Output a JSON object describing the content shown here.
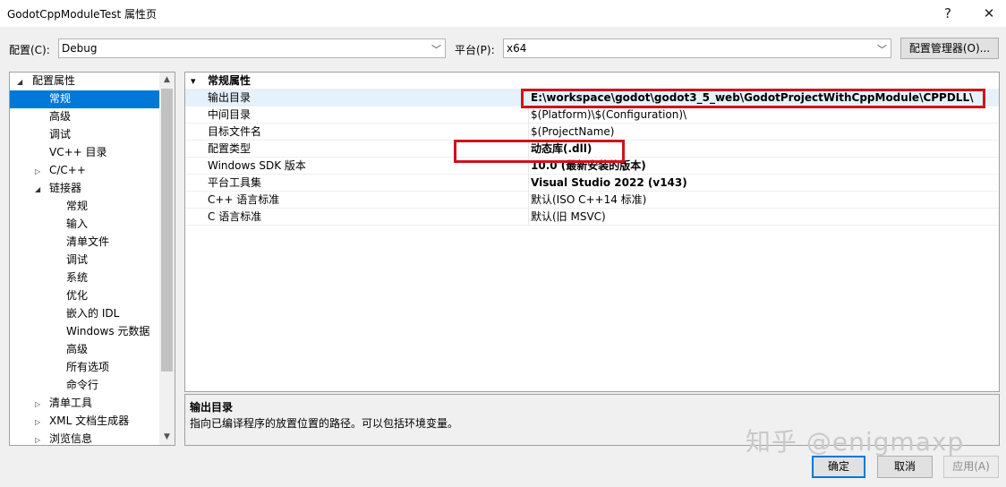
{
  "window": {
    "title": "GodotCppModuleTest 属性页",
    "help": "?",
    "close": "✕"
  },
  "config": {
    "label": "配置(C):",
    "value": "Debug"
  },
  "platform": {
    "label": "平台(P):",
    "value": "x64"
  },
  "config_manager": "配置管理器(O)...",
  "tree": {
    "items": [
      {
        "label": "配置属性",
        "expander": "◢"
      },
      {
        "label": "常规"
      },
      {
        "label": "高级"
      },
      {
        "label": "调试"
      },
      {
        "label": "VC++ 目录"
      },
      {
        "label": "C/C++",
        "expander": "▷"
      },
      {
        "label": "链接器",
        "expander": "◢"
      },
      {
        "label": "常规"
      },
      {
        "label": "输入"
      },
      {
        "label": "清单文件"
      },
      {
        "label": "调试"
      },
      {
        "label": "系统"
      },
      {
        "label": "优化"
      },
      {
        "label": "嵌入的 IDL"
      },
      {
        "label": "Windows 元数据"
      },
      {
        "label": "高级"
      },
      {
        "label": "所有选项"
      },
      {
        "label": "命令行"
      },
      {
        "label": "清单工具",
        "expander": "▷"
      },
      {
        "label": "XML 文档生成器",
        "expander": "▷"
      },
      {
        "label": "浏览信息",
        "expander": "▷"
      }
    ]
  },
  "grid": {
    "section": "常规属性",
    "section_expander": "▾",
    "rows": [
      {
        "name": "输出目录",
        "value": "E:\\workspace\\godot\\godot3_5_web\\GodotProjectWithCppModule\\CPPDLL\\"
      },
      {
        "name": "中间目录",
        "value": "$(Platform)\\$(Configuration)\\"
      },
      {
        "name": "目标文件名",
        "value": "$(ProjectName)"
      },
      {
        "name": "配置类型",
        "value": "动态库(.dll)"
      },
      {
        "name": "Windows SDK 版本",
        "value": "10.0 (最新安装的版本)"
      },
      {
        "name": "平台工具集",
        "value": "Visual Studio 2022 (v143)"
      },
      {
        "name": "C++ 语言标准",
        "value": "默认(ISO C++14 标准)"
      },
      {
        "name": "C 语言标准",
        "value": "默认(旧 MSVC)"
      }
    ]
  },
  "description": {
    "title": "输出目录",
    "text": "指向已编译程序的放置位置的路径。可以包括环境变量。"
  },
  "buttons": {
    "ok": "确定",
    "cancel": "取消",
    "apply": "应用(A)"
  },
  "watermark": "知乎 @enigmaxp",
  "colors": {
    "accent": "#0078d7",
    "highlight": "#d0121b"
  }
}
